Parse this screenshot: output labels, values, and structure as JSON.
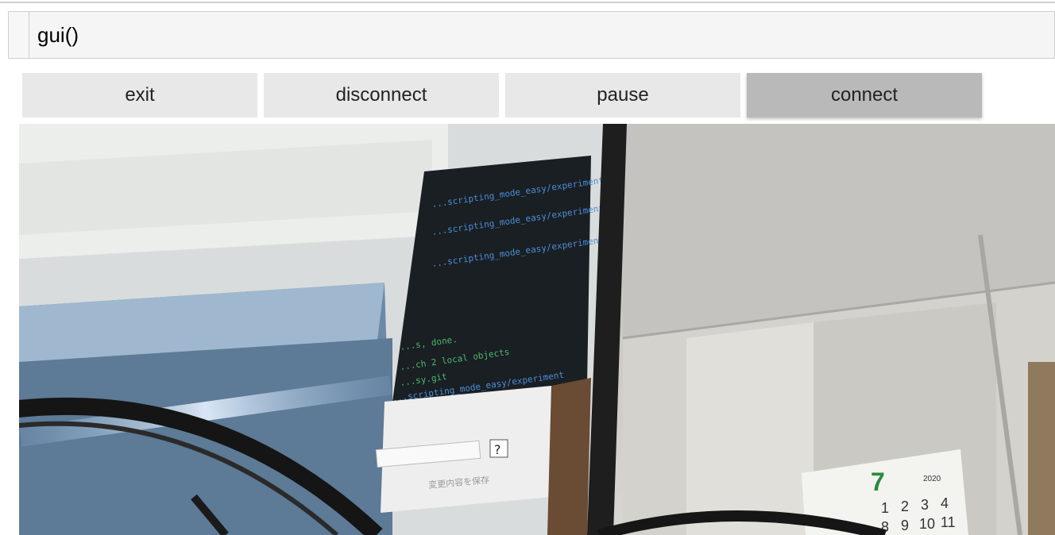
{
  "cell": {
    "code": "gui()"
  },
  "buttons": [
    {
      "label": "exit",
      "active": false
    },
    {
      "label": "disconnect",
      "active": false
    },
    {
      "label": "pause",
      "active": false
    },
    {
      "label": "connect",
      "active": true
    }
  ],
  "video": {
    "description_icon": "webcam-frame",
    "terminal_lines": [
      "...scripting_mode_easy/experiment",
      "...scripting_mode_easy/experiment",
      "...scripting_mode_easy/experiment",
      "...s, done.",
      "...ch 2 local objects",
      "...sy.git",
      "...scripting_mode_easy/experiment"
    ],
    "save_button_text": "変更内容を保存",
    "calendar_month": "7",
    "calendar_year": "2020",
    "calendar_row1": [
      "1",
      "2",
      "3",
      "4"
    ],
    "calendar_row2": [
      "8",
      "9",
      "10",
      "11"
    ]
  }
}
